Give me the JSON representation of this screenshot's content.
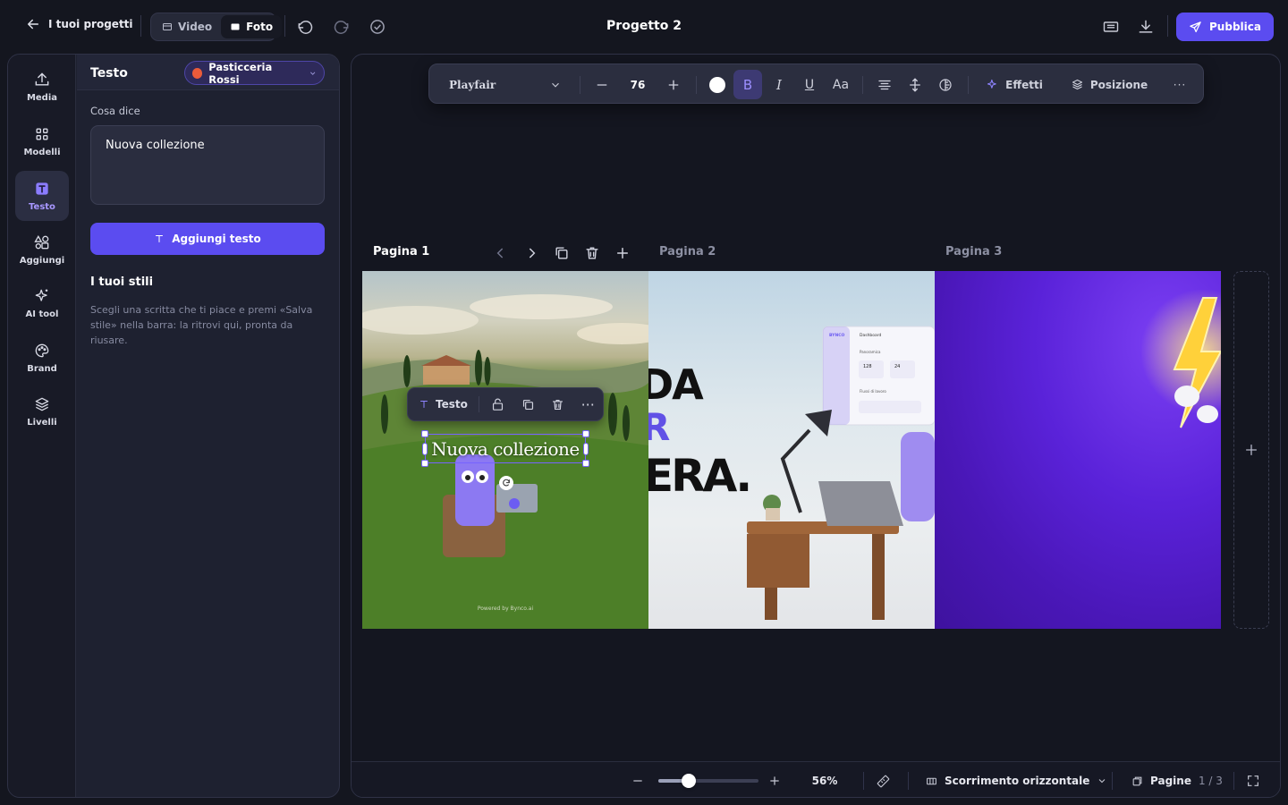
{
  "topbar": {
    "back_label": "I tuoi progetti",
    "mode_video": "Video",
    "mode_photo": "Foto",
    "project_title": "Progetto 2",
    "publish_label": "Pubblica"
  },
  "rail": [
    {
      "label": "Media",
      "icon": "upload-icon"
    },
    {
      "label": "Modelli",
      "icon": "grid-icon"
    },
    {
      "label": "Testo",
      "icon": "text-icon",
      "active": true
    },
    {
      "label": "Aggiungi",
      "icon": "shapes-icon"
    },
    {
      "label": "AI tool",
      "icon": "sparkle-icon"
    },
    {
      "label": "Brand",
      "icon": "palette-icon"
    },
    {
      "label": "Livelli",
      "icon": "layers-icon"
    }
  ],
  "panel": {
    "title": "Testo",
    "brand_name": "Pasticceria Rossi",
    "content_label": "Cosa dice",
    "content_value": "Nuova collezione",
    "add_text_label": "Aggiungi testo",
    "styles_title": "I tuoi stili",
    "styles_hint": "Scegli una scritta che ti piace e premi «Salva stile» nella barra: la ritrovi qui, pronta da riusare."
  },
  "format_toolbar": {
    "font": "Playfair",
    "size": "76",
    "effects_label": "Effetti",
    "position_label": "Posizione"
  },
  "pages": [
    {
      "label": "Pagina 1",
      "active": true
    },
    {
      "label": "Pagina 2"
    },
    {
      "label": "Pagina 3"
    }
  ],
  "element_toolbar": {
    "label": "Testo"
  },
  "canvas_text": {
    "selected_text": "Nuova collezione",
    "page2_fragment_1": "DA",
    "page2_fragment_2": "R",
    "page2_fragment_3": "ERA.",
    "watermark": "Powered by Bynco.ai"
  },
  "dashboard_mock": {
    "app": "BYNCO",
    "title": "Dashboard",
    "overview": "Panoramica",
    "stat1": "128",
    "stat2": "24",
    "section": "Flussi di lavoro"
  },
  "bottombar": {
    "zoom": "56%",
    "zoom_fraction": 0.3,
    "scroll_mode": "Scorrimento orizzontale",
    "pages_label": "Pagine",
    "pages_count": "1 / 3"
  },
  "colors": {
    "accent": "#5b4cf0",
    "brand_dot": "#ea5b3a",
    "panel_bg": "#1e2130",
    "canvas_bg": "#141620"
  }
}
